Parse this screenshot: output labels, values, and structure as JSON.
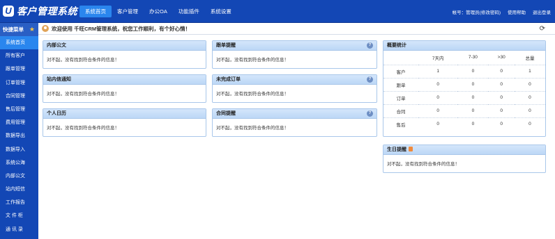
{
  "app": {
    "logo_letter": "U",
    "title": "客户管理系统"
  },
  "nav": {
    "items": [
      "系统首页",
      "客户管理",
      "办公OA",
      "功能插件",
      "系统设置"
    ],
    "active": "系统首页"
  },
  "account": {
    "user_label": "帐号：管理员(修改密码)",
    "help_label": "使用帮助",
    "logout_label": "退出登录"
  },
  "sidebar": {
    "header": "快捷菜单",
    "items": [
      "系统首页",
      "所有客户",
      "跟单管理",
      "订单管理",
      "合同管理",
      "售后管理",
      "费用管理",
      "数据导出",
      "数据导入",
      "系统公海",
      "内部公文",
      "站内短信",
      "工作报告",
      "文 件 柜",
      "通 讯 录"
    ]
  },
  "welcome": {
    "text": "欢迎使用 千旺CRM管理系统，祝您工作顺利，有个好心情！"
  },
  "empty_message": "对不起，没有找到符合条件的信息！",
  "panels": {
    "internal_docs": "内部公文",
    "followup_reminder": "跟单提醒",
    "site_messages": "站内信通知",
    "pending_orders": "未完成订单",
    "calendar": "个人日历",
    "contract_reminder": "合同提醒",
    "birthday_reminder": "生日提醒"
  },
  "stats": {
    "title": "概要统计",
    "columns": [
      "",
      "7天内",
      "7-30",
      ">30",
      "总量"
    ],
    "rows": [
      {
        "label": "客户",
        "values": [
          "1",
          "0",
          "0",
          "1"
        ]
      },
      {
        "label": "跟单",
        "values": [
          "0",
          "0",
          "0",
          "0"
        ]
      },
      {
        "label": "订单",
        "values": [
          "0",
          "0",
          "0",
          "0"
        ]
      },
      {
        "label": "合同",
        "values": [
          "0",
          "0",
          "0",
          "0"
        ]
      },
      {
        "label": "售后",
        "values": [
          "0",
          "0",
          "0",
          "0"
        ]
      }
    ]
  }
}
